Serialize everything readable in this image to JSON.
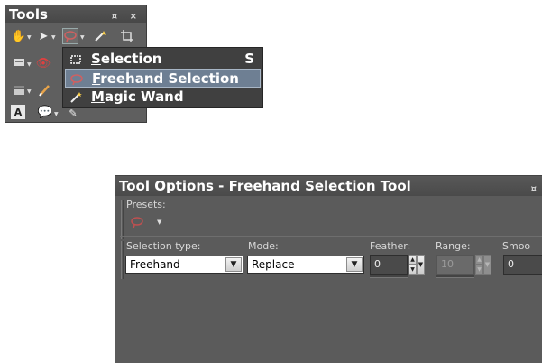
{
  "tools_palette": {
    "title": "Tools",
    "window_buttons": "¤ ×",
    "icons": [
      "pan-hand-icon",
      "pick-arrow-icon",
      "freehand-lasso-icon",
      "magic-wand-icon",
      "crop-icon",
      "screen-icon",
      "red-eye-icon",
      "fill-icon",
      "brush-icon",
      "text-icon",
      "preset-shape-icon",
      "pen-icon"
    ]
  },
  "flyout_menu": {
    "items": [
      {
        "label": "Selection",
        "shortcut": "S",
        "icon": "rectangle-selection-icon",
        "selected": false
      },
      {
        "label": "Freehand Selection",
        "shortcut": "",
        "icon": "freehand-lasso-icon",
        "selected": true
      },
      {
        "label": "Magic Wand",
        "shortcut": "",
        "icon": "magic-wand-icon",
        "selected": false
      }
    ]
  },
  "tool_options": {
    "title": "Tool Options - Freehand Selection Tool",
    "pin_icon": "¤",
    "presets_label": "Presets:",
    "selection_type": {
      "label": "Selection type:",
      "value": "Freehand"
    },
    "mode": {
      "label": "Mode:",
      "value": "Replace"
    },
    "feather": {
      "label": "Feather:",
      "value": "0"
    },
    "range": {
      "label": "Range:",
      "value": "10",
      "disabled": true
    },
    "smoothing": {
      "label": "Smoo",
      "value": "0"
    }
  }
}
